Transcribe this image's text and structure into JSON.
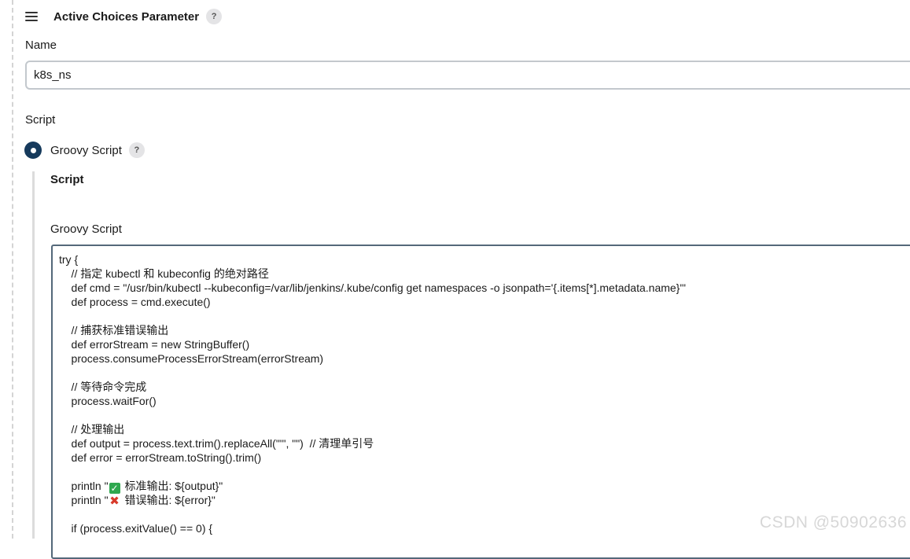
{
  "header": {
    "title": "Active Choices Parameter",
    "help_glyph": "?"
  },
  "name_field": {
    "label": "Name",
    "value": "k8s_ns"
  },
  "script_section": {
    "label": "Script",
    "radio_label": "Groovy Script",
    "radio_selected": true,
    "help_glyph": "?",
    "sub_title": "Script",
    "code_label": "Groovy Script"
  },
  "code": {
    "lines": [
      {
        "text": "try {"
      },
      {
        "text": "    // 指定 kubectl 和 kubeconfig 的绝对路径"
      },
      {
        "text": "    def cmd = \"/usr/bin/kubectl --kubeconfig=/var/lib/jenkins/.kube/config get namespaces -o jsonpath='{.items[*].metadata.name}'\""
      },
      {
        "text": "    def process = cmd.execute()"
      },
      {
        "text": ""
      },
      {
        "text": "    // 捕获标准错误输出"
      },
      {
        "text": "    def errorStream = new StringBuffer()"
      },
      {
        "text": "    process.consumeProcessErrorStream(errorStream)"
      },
      {
        "text": ""
      },
      {
        "text": "    // 等待命令完成"
      },
      {
        "text": "    process.waitFor()"
      },
      {
        "text": ""
      },
      {
        "text": "    // 处理输出"
      },
      {
        "text": "    def output = process.text.trim().replaceAll(\"'\", \"\")  // 清理单引号"
      },
      {
        "text": "    def error = errorStream.toString().trim()"
      },
      {
        "text": ""
      },
      {
        "prefix": "    println \"",
        "icon": "check-mark-emoji",
        "suffix": " 标准输出: ${output}\""
      },
      {
        "prefix": "    println \"",
        "icon": "cross-mark-emoji",
        "suffix": " 错误输出: ${error}\""
      },
      {
        "text": ""
      },
      {
        "text": "    if (process.exitValue() == 0) {"
      }
    ]
  },
  "icons": {
    "drag_handle": "hamburger-menu-icon",
    "check": "✓",
    "cross": "✖"
  },
  "colors": {
    "radio_selected": "#163a5c",
    "code_border": "#54687a",
    "input_border": "#c3c8cd"
  },
  "watermark": "CSDN @50902636"
}
